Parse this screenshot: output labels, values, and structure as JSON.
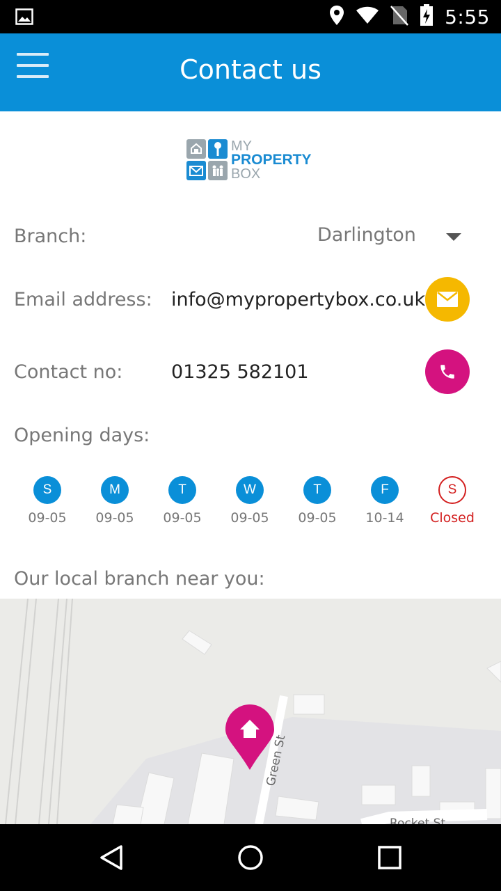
{
  "status_bar": {
    "time": "5:55",
    "icons": [
      "image-icon",
      "location-icon",
      "wifi-icon",
      "no-sim-icon",
      "battery-charging-icon"
    ]
  },
  "app_bar": {
    "title": "Contact us",
    "menu_icon": "hamburger-menu-icon",
    "color": "#0a8fd8"
  },
  "logo": {
    "line1": "MY",
    "line2": "PROPERTY",
    "line3": "BOX"
  },
  "branch": {
    "label": "Branch:",
    "selected": "Darlington"
  },
  "email": {
    "label": "Email address:",
    "value": "info@mypropertybox.co.uk",
    "button_icon": "envelope-icon",
    "button_color": "#f5b800"
  },
  "contact": {
    "label": "Contact no:",
    "value": "01325 582101",
    "button_icon": "phone-icon",
    "button_color": "#d4127f"
  },
  "opening": {
    "label": "Opening days:",
    "days": [
      {
        "letter": "S",
        "hours": "09-05",
        "closed": false
      },
      {
        "letter": "M",
        "hours": "09-05",
        "closed": false
      },
      {
        "letter": "T",
        "hours": "09-05",
        "closed": false
      },
      {
        "letter": "W",
        "hours": "09-05",
        "closed": false
      },
      {
        "letter": "T",
        "hours": "09-05",
        "closed": false
      },
      {
        "letter": "F",
        "hours": "10-14",
        "closed": false
      },
      {
        "letter": "S",
        "hours": "Closed",
        "closed": true
      }
    ]
  },
  "map": {
    "heading": "Our local branch near you:",
    "street1": "Green St",
    "street2": "Rocket St",
    "marker_icon": "home-marker-icon",
    "marker_color": "#d4127f"
  },
  "nav_bar": {
    "icons": [
      "back-icon",
      "home-icon",
      "recents-icon"
    ]
  }
}
